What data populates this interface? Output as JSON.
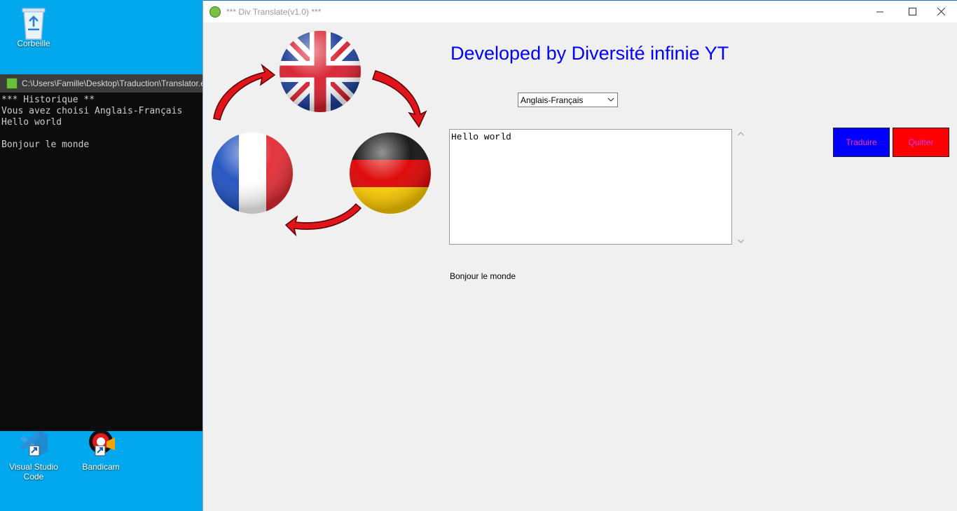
{
  "desktop": {
    "icons": [
      {
        "label": "Corbeille",
        "icon": "recycle-bin-icon"
      },
      {
        "label": "Visual Studio Code",
        "icon": "vscode-icon"
      },
      {
        "label": "Bandicam",
        "icon": "bandicam-icon"
      }
    ]
  },
  "console": {
    "title": "C:\\Users\\Famille\\Desktop\\Traduction\\Translator.e",
    "lines": "*** Historique **\nVous avez choisi Anglais-Français\nHello world\n\nBonjour le monde"
  },
  "app": {
    "title": "*** Div Translate(v1.0) ***",
    "heading": "Developed by Diversité infinie YT",
    "language_select": {
      "value": "Anglais-Français"
    },
    "input_text": "Hello world",
    "buttons": {
      "translate": "Traduire",
      "quit": "Quitter"
    },
    "result_text": "Bonjour le monde",
    "logo_flags": [
      "uk-flag-icon",
      "germany-flag-icon",
      "france-flag-icon"
    ],
    "colors": {
      "heading": "#0000ff",
      "translate_bg": "#0000ff",
      "quit_bg": "#ff0000",
      "button_text": "#ff3399"
    }
  }
}
